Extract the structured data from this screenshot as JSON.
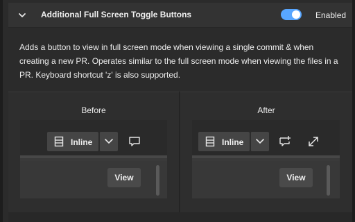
{
  "header": {
    "title": "Additional Full Screen Toggle Buttons",
    "status": "Enabled",
    "toggle_on": true,
    "accent": "#58a6ff"
  },
  "description": "Adds a button to view in full screen mode when viewing a single commit & when creating a new PR. Operates similar to the full screen mode when viewing the files in a PR. Keyboard shortcut 'z' is also supported.",
  "before": {
    "title": "Before",
    "mode_label": "Inline",
    "view_label": "View",
    "icons": [
      "file-icon",
      "chevron-down-icon",
      "comment-icon"
    ]
  },
  "after": {
    "title": "After",
    "mode_label": "Inline",
    "view_label": "View",
    "icons": [
      "file-icon",
      "chevron-down-icon",
      "comment-add-icon",
      "expand-icon"
    ]
  }
}
